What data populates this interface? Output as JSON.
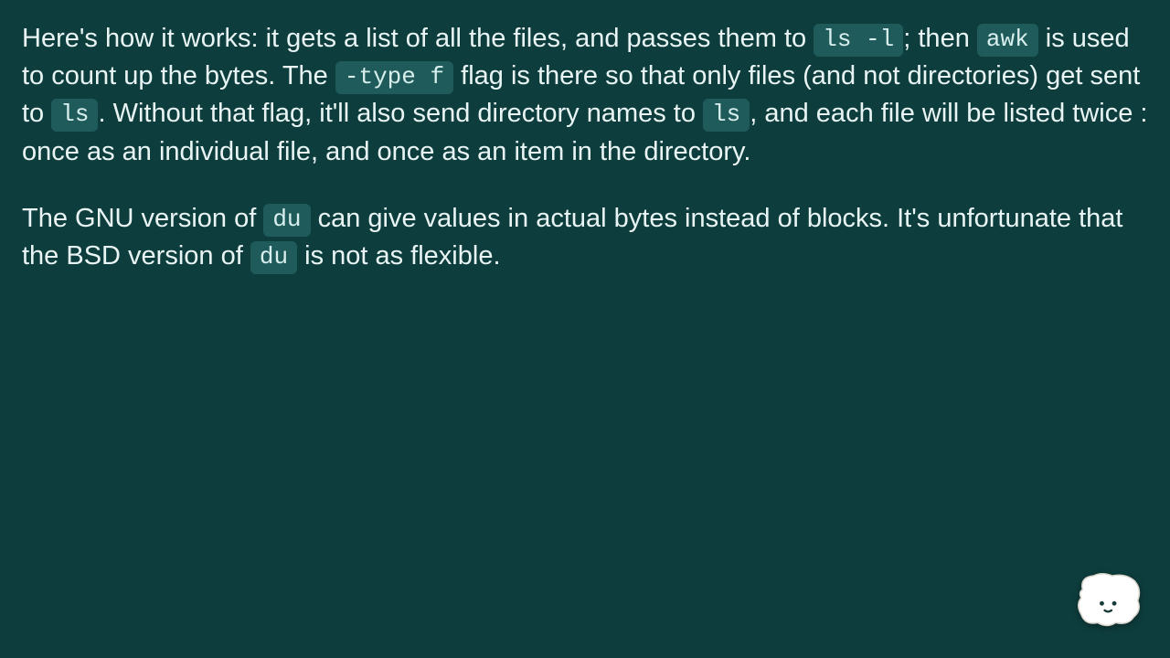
{
  "p1": {
    "t1": "Here's how it works: it gets a list of all the files, and passes them to ",
    "c1": "ls -l",
    "t2": "; then ",
    "c2": "awk",
    "t3": " is used to count up the bytes. The ",
    "c3": "-type f",
    "t4": " flag is there so that only files (and not directories) get sent to ",
    "c4": "ls",
    "t5": ". Without that flag, it'll also send directory names to ",
    "c5": "ls",
    "t6": ", and each file will be listed twice : once as an individual file, and once as an item in the directory."
  },
  "p2": {
    "t1": "The GNU version of ",
    "c1": "du",
    "t2": " can give values in actual bytes instead of blocks. It's unfortunate that the BSD version of ",
    "c2": "du",
    "t3": " is not as flexible."
  }
}
